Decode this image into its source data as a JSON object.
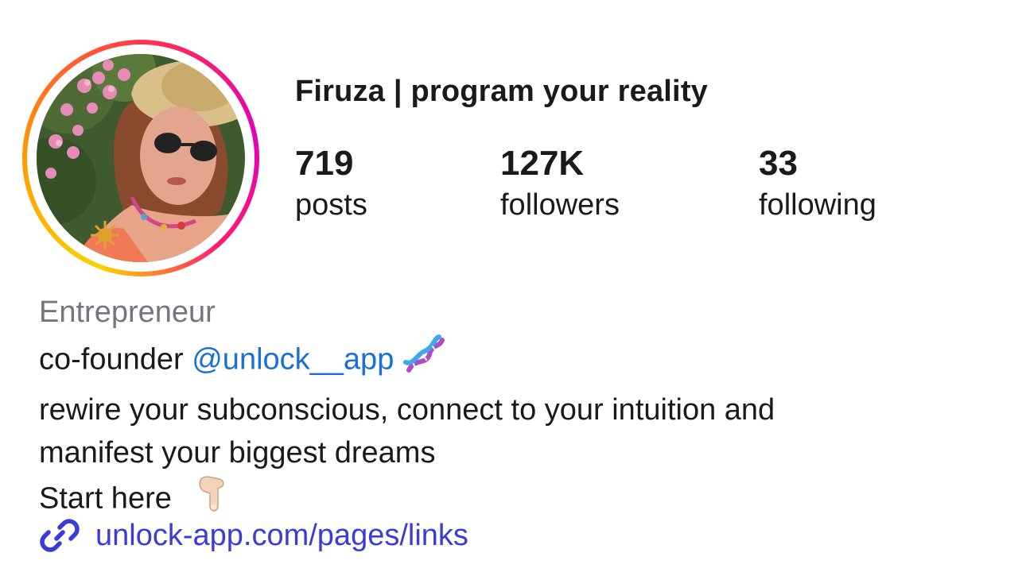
{
  "profile": {
    "display_name": "Firuza | program your reality",
    "avatar_icon": "profile-photo",
    "story_ring_colors": [
      "#fcd200",
      "#ff9a00",
      "#ff2d55",
      "#e200b8"
    ]
  },
  "stats": {
    "posts": {
      "value": "719",
      "label": "posts"
    },
    "followers": {
      "value": "127K",
      "label": "followers"
    },
    "following": {
      "value": "33",
      "label": "following"
    }
  },
  "bio": {
    "category": "Entrepreneur",
    "line1_prefix": "co-founder",
    "mention": "@unlock__app",
    "line1_emoji": "dna-icon",
    "line2": "rewire your subconscious, connect to your intuition and",
    "line3": "manifest your biggest dreams",
    "line4": "Start here",
    "line4_emoji": "pointing-down-icon"
  },
  "link": {
    "icon": "link-icon",
    "url_text": "unlock-app.com/pages/links"
  },
  "colors": {
    "mention": "#1a6fd8",
    "link": "#3b3bd8",
    "category": "#72767e",
    "text": "#1a1a1a"
  }
}
